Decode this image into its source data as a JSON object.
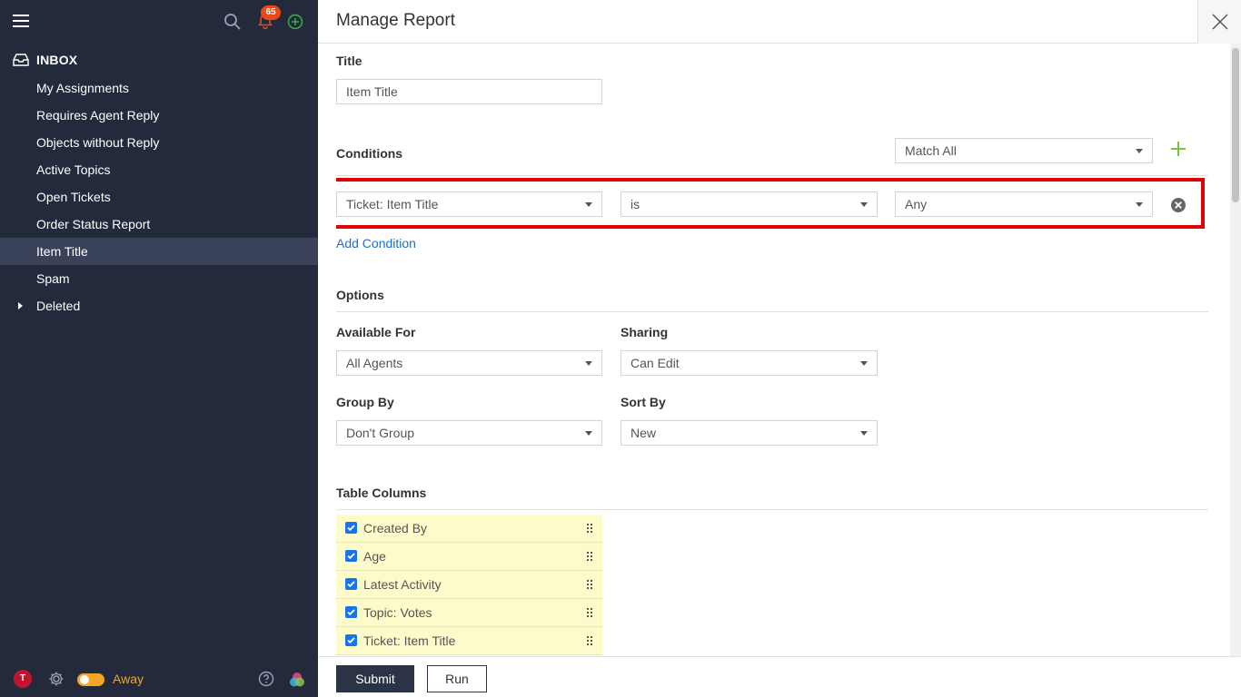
{
  "sidebar": {
    "notification_count": "65",
    "inbox_label": "INBOX",
    "items": [
      {
        "label": "My Assignments"
      },
      {
        "label": "Requires Agent Reply"
      },
      {
        "label": "Objects without Reply"
      },
      {
        "label": "Active Topics"
      },
      {
        "label": "Open Tickets"
      },
      {
        "label": "Order Status Report"
      },
      {
        "label": "Item Title"
      },
      {
        "label": "Spam"
      },
      {
        "label": "Deleted"
      }
    ],
    "active_item": "Item Title",
    "user_initial": "T",
    "status_label": "Away",
    "colors": {
      "background": "#232a3b",
      "active": "#394259",
      "away": "#f5a623",
      "badge": "#e64a19"
    }
  },
  "modal": {
    "title": "Manage Report",
    "title_section": {
      "label": "Title",
      "value": "Item Title"
    },
    "conditions": {
      "label": "Conditions",
      "match_mode": "Match All",
      "rows": [
        {
          "field": "Ticket: Item Title",
          "operator": "is",
          "value": "Any"
        }
      ],
      "add_link": "Add Condition"
    },
    "options": {
      "label": "Options",
      "available_for": {
        "label": "Available For",
        "value": "All Agents"
      },
      "sharing": {
        "label": "Sharing",
        "value": "Can Edit"
      },
      "group_by": {
        "label": "Group By",
        "value": "Don't Group"
      },
      "sort_by": {
        "label": "Sort By",
        "value": "New"
      }
    },
    "table_columns": {
      "label": "Table Columns",
      "items": [
        {
          "label": "Created By",
          "checked": true
        },
        {
          "label": "Age",
          "checked": true
        },
        {
          "label": "Latest Activity",
          "checked": true
        },
        {
          "label": "Topic: Votes",
          "checked": true
        },
        {
          "label": "Ticket: Item Title",
          "checked": true
        }
      ]
    },
    "buttons": {
      "submit": "Submit",
      "run": "Run"
    }
  }
}
